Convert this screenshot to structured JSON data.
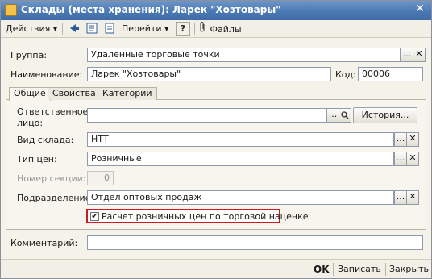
{
  "window": {
    "title": "Склады (места хранения): Ларек \"Хозтовары\"",
    "close_glyph": "✕"
  },
  "toolbar": {
    "actions_label": "Действия",
    "goto_label": "Перейти",
    "help_label": "?",
    "files_label": "Файлы",
    "dropdown_glyph": "▾"
  },
  "form": {
    "group_label": "Группа:",
    "group_value": "Удаленные торговые точки",
    "name_label": "Наименование:",
    "name_value": "Ларек \"Хозтовары\"",
    "code_label": "Код:",
    "code_value": "00006",
    "comment_label": "Комментарий:",
    "comment_value": ""
  },
  "tabs": [
    {
      "label": "Общие"
    },
    {
      "label": "Свойства"
    },
    {
      "label": "Категории"
    }
  ],
  "general": {
    "responsible_label_line1": "Ответственное",
    "responsible_label_line2": "лицо:",
    "responsible_value": "",
    "history_button": "История...",
    "warehouse_type_label": "Вид склада:",
    "warehouse_type_value": "НТТ",
    "price_type_label": "Тип цен:",
    "price_type_value": "Розничные",
    "section_label": "Номер секции:",
    "section_value": "0",
    "division_label": "Подразделение:",
    "division_value": "Отдел оптовых продаж",
    "retail_checkbox_label": "Расчет розничных цен по торговой наценке",
    "retail_checkbox_checked": true,
    "check_glyph": "✔"
  },
  "buttons": {
    "ellipsis": "...",
    "clear": "✕",
    "search": "⚲",
    "ok": "OK",
    "save": "Записать",
    "close": "Закрыть"
  },
  "colors": {
    "title_bar": "#4b79b3",
    "highlight_border": "#d21a1a"
  }
}
